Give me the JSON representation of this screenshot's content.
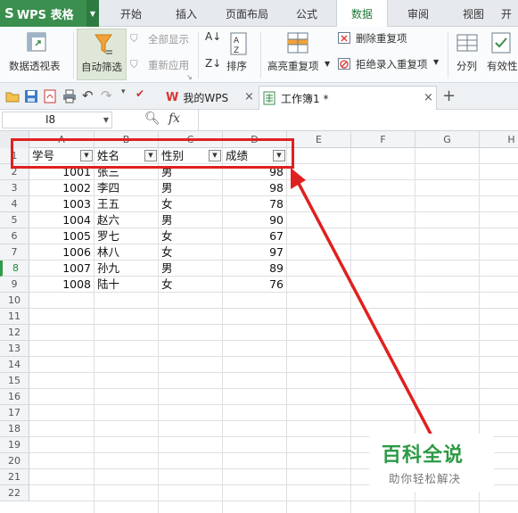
{
  "app": {
    "title": "WPS 表格"
  },
  "menu_tabs": [
    {
      "label": "开始"
    },
    {
      "label": "插入"
    },
    {
      "label": "页面布局"
    },
    {
      "label": "公式"
    },
    {
      "label": "数据",
      "active": true
    },
    {
      "label": "审阅"
    },
    {
      "label": "视图"
    },
    {
      "label": "开"
    }
  ],
  "ribbon": {
    "pivot_table": "数据透视表",
    "auto_filter": "自动筛选",
    "show_all": "全部显示",
    "reapply": "重新应用",
    "sort": "排序",
    "highlight_duplicates": "高亮重复项",
    "remove_duplicates": "删除重复项",
    "reject_duplicates": "拒绝录入重复项",
    "split": "分列",
    "validity": "有效性"
  },
  "doc_tabs": {
    "my_wps": "我的WPS",
    "workbook": "工作簿1 *"
  },
  "formula_bar": {
    "name_box": "I8",
    "fx": "fx"
  },
  "sheet": {
    "columns": [
      "A",
      "B",
      "C",
      "D",
      "E",
      "F",
      "G",
      "H"
    ],
    "row_numbers": [
      "1",
      "2",
      "3",
      "4",
      "5",
      "6",
      "7",
      "8",
      "9",
      "10",
      "11",
      "12",
      "13",
      "14",
      "15",
      "16",
      "17",
      "18",
      "19",
      "20",
      "21",
      "22"
    ],
    "selected_row": "8",
    "headers": [
      "学号",
      "姓名",
      "性别",
      "成绩"
    ],
    "rows": [
      [
        "1001",
        "张三",
        "男",
        "98"
      ],
      [
        "1002",
        "李四",
        "男",
        "98"
      ],
      [
        "1003",
        "王五",
        "女",
        "78"
      ],
      [
        "1004",
        "赵六",
        "男",
        "90"
      ],
      [
        "1005",
        "罗七",
        "女",
        "67"
      ],
      [
        "1006",
        "林八",
        "女",
        "97"
      ],
      [
        "1007",
        "孙九",
        "男",
        "89"
      ],
      [
        "1008",
        "陆十",
        "女",
        "76"
      ]
    ]
  },
  "annotation": {
    "color": "#e02020"
  },
  "watermark": {
    "title": "百科全说",
    "subtitle": "助你轻松解决"
  },
  "colors": {
    "brand": "#3a8e4e",
    "accent_text": "#1d7a34"
  }
}
